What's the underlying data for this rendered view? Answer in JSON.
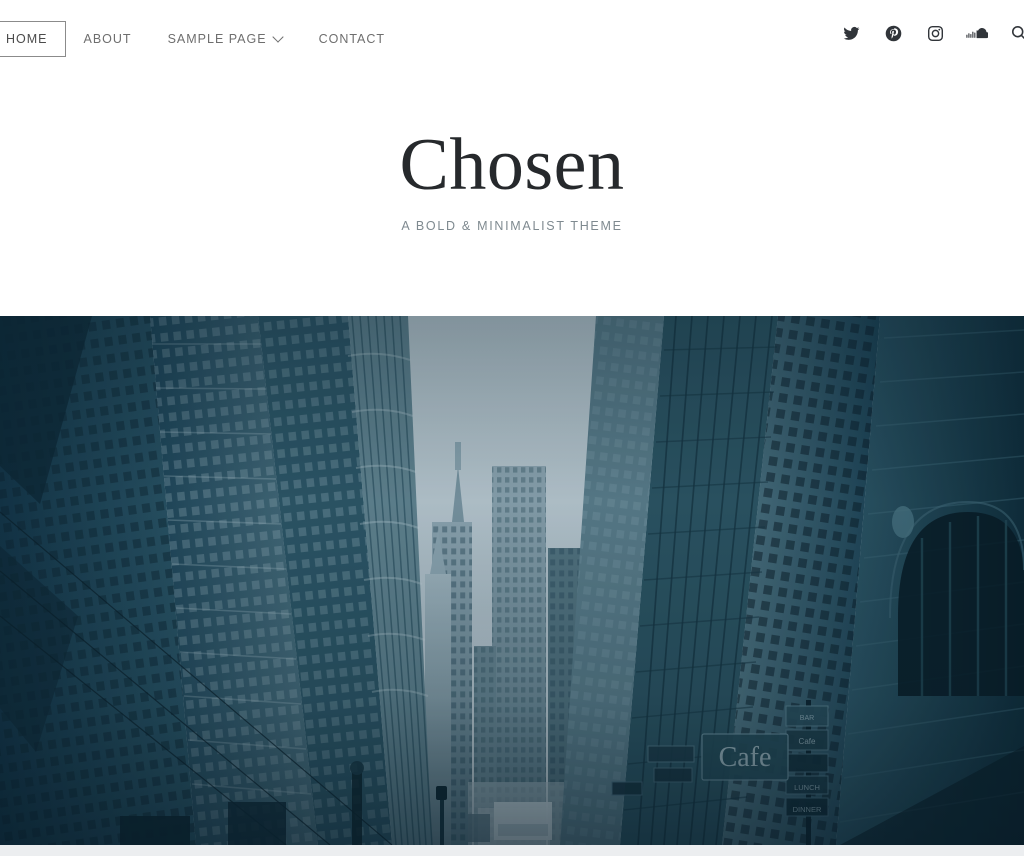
{
  "site": {
    "title": "Chosen",
    "tagline": "A BOLD & MINIMALIST THEME"
  },
  "nav": {
    "items": [
      {
        "label": "HOME",
        "active": true,
        "has_dropdown": false
      },
      {
        "label": "ABOUT",
        "active": false,
        "has_dropdown": false
      },
      {
        "label": "SAMPLE PAGE",
        "active": false,
        "has_dropdown": true
      },
      {
        "label": "CONTACT",
        "active": false,
        "has_dropdown": false
      }
    ]
  },
  "social": {
    "items": [
      {
        "icon": "twitter-icon",
        "label": "Twitter"
      },
      {
        "icon": "pinterest-icon",
        "label": "Pinterest"
      },
      {
        "icon": "instagram-icon",
        "label": "Instagram"
      },
      {
        "icon": "soundcloud-icon",
        "label": "SoundCloud"
      }
    ],
    "search": {
      "icon": "search-icon",
      "label": "Search"
    }
  },
  "hero": {
    "alt": "City street canyon with tall buildings looking upward",
    "signage": [
      "Cafe",
      "LUNCH",
      "DINNER"
    ]
  },
  "colors": {
    "page_background": "#ffffff",
    "nav_text": "#6e6e6e",
    "nav_active_border": "#8b8b8b",
    "title_text": "#26292c",
    "tagline_text": "#7f8a90",
    "social_icon": "#31353a",
    "hero_sky": "#bcc9d0",
    "hero_building_dark": "#1a3a4a",
    "hero_building_mid": "#2c4f5e",
    "hero_building_light": "#6e8a96",
    "hero_deep_shadow": "#0d2430",
    "bottom_strip": "#eceef0"
  }
}
